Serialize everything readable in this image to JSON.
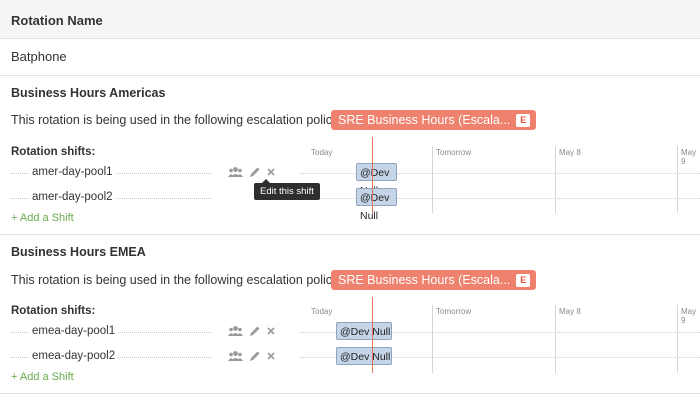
{
  "header": {
    "title": "Rotation Name"
  },
  "rotation": {
    "name": "Batphone"
  },
  "used_text": "This rotation is being used in the following escalation policies:",
  "shifts_label": "Rotation shifts:",
  "add_shift": "+ Add a Shift",
  "timeline": {
    "days": [
      "Today",
      "Tomorrow",
      "May 8",
      "May 9"
    ]
  },
  "tooltip": "Edit this shift",
  "sections": [
    {
      "title": "Business Hours Americas",
      "policy": {
        "label": "SRE Business Hours (Escala...",
        "badge": "E"
      },
      "shifts": [
        {
          "name": "amer-day-pool1",
          "oncall": "@Dev Null"
        },
        {
          "name": "amer-day-pool2",
          "oncall": "@Dev Null"
        }
      ]
    },
    {
      "title": "Business Hours EMEA",
      "policy": {
        "label": "SRE Business Hours (Escala...",
        "badge": "E"
      },
      "shifts": [
        {
          "name": "emea-day-pool1",
          "oncall": "@Dev Null"
        },
        {
          "name": "emea-day-pool2",
          "oncall": "@Dev Null"
        }
      ]
    }
  ],
  "colors": {
    "policy_badge": "#ef826e",
    "now_line": "#e8735c",
    "oncall_block": "#c5d4e6",
    "add_link": "#6aaa4e"
  },
  "icons": [
    "group-icon",
    "pencil-icon",
    "close-icon"
  ]
}
